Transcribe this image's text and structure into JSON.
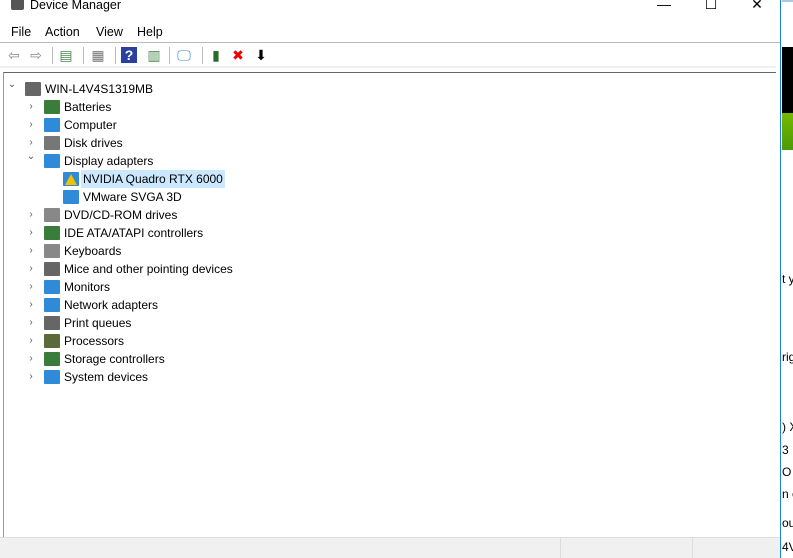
{
  "window": {
    "title": "Device Manager",
    "controls": [
      "—",
      "☐",
      "✕"
    ]
  },
  "menu": [
    "File",
    "Action",
    "View",
    "Help"
  ],
  "toolbar": [
    {
      "name": "back-icon",
      "glyph": "⇦"
    },
    {
      "name": "forward-icon",
      "glyph": "⇨"
    },
    {
      "name": "show-hide-console-tree-icon",
      "glyph": "▤"
    },
    {
      "name": "properties-icon",
      "glyph": "▦"
    },
    {
      "name": "help-icon",
      "glyph": "?"
    },
    {
      "name": "action-pane-icon",
      "glyph": "▥"
    },
    {
      "name": "scan-hardware-icon",
      "glyph": "🖵"
    },
    {
      "name": "update-driver-icon",
      "glyph": "▮"
    },
    {
      "name": "uninstall-icon",
      "glyph": "✖"
    },
    {
      "name": "disable-icon",
      "glyph": "⬇"
    }
  ],
  "tree": {
    "root": "WIN-L4V4S1319MB",
    "categories": [
      {
        "label": "Batteries",
        "expanded": false,
        "color": "#3a7d3a"
      },
      {
        "label": "Computer",
        "expanded": false,
        "color": "#2f8ad8"
      },
      {
        "label": "Disk drives",
        "expanded": false,
        "color": "#777"
      },
      {
        "label": "Display adapters",
        "expanded": true,
        "color": "#2f8ad8",
        "children": [
          {
            "label": "NVIDIA Quadro RTX 6000",
            "warning": true,
            "selected": true
          },
          {
            "label": "VMware SVGA 3D",
            "warning": false,
            "selected": false
          }
        ]
      },
      {
        "label": "DVD/CD-ROM drives",
        "expanded": false,
        "color": "#888"
      },
      {
        "label": "IDE ATA/ATAPI controllers",
        "expanded": false,
        "color": "#3a7d3a"
      },
      {
        "label": "Keyboards",
        "expanded": false,
        "color": "#888"
      },
      {
        "label": "Mice and other pointing devices",
        "expanded": false,
        "color": "#666"
      },
      {
        "label": "Monitors",
        "expanded": false,
        "color": "#2f8ad8"
      },
      {
        "label": "Network adapters",
        "expanded": false,
        "color": "#2f8ad8"
      },
      {
        "label": "Print queues",
        "expanded": false,
        "color": "#666"
      },
      {
        "label": "Processors",
        "expanded": false,
        "color": "#5a6a3a"
      },
      {
        "label": "Storage controllers",
        "expanded": false,
        "color": "#3a7d3a"
      },
      {
        "label": "System devices",
        "expanded": false,
        "color": "#2f8ad8"
      }
    ]
  },
  "background_fragments": [
    "t y",
    "rig",
    ") X",
    "3",
    " O",
    "n c",
    "ou",
    "4V"
  ]
}
